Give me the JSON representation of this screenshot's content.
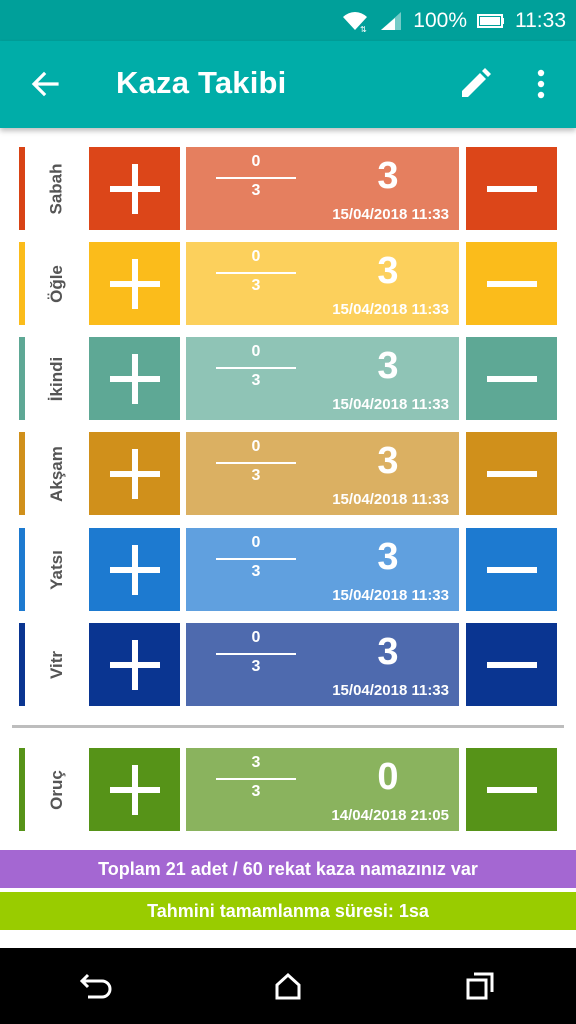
{
  "status_bar": {
    "battery": "100%",
    "time": "11:33"
  },
  "app_bar": {
    "title": "Kaza Takibi"
  },
  "prayers": [
    {
      "name": "Sabah",
      "done": "0",
      "total": "3",
      "remaining": "3",
      "timestamp": "15/04/2018 11:33",
      "stripe": "#d84315",
      "plus": "#dc4619",
      "middle": "#e57f5f",
      "minus": "#dc4619"
    },
    {
      "name": "Öğle",
      "done": "0",
      "total": "3",
      "remaining": "3",
      "timestamp": "15/04/2018 11:33",
      "stripe": "#fbbc1b",
      "plus": "#fbbc1b",
      "middle": "#fcd05c",
      "minus": "#fbbc1b"
    },
    {
      "name": "İkindi",
      "done": "0",
      "total": "3",
      "remaining": "3",
      "timestamp": "15/04/2018 11:33",
      "stripe": "#5ea895",
      "plus": "#5ea895",
      "middle": "#8fc4b6",
      "minus": "#5ea895"
    },
    {
      "name": "Akşam",
      "done": "0",
      "total": "3",
      "remaining": "3",
      "timestamp": "15/04/2018 11:33",
      "stripe": "#d0901b",
      "plus": "#d0901b",
      "middle": "#dbb062",
      "minus": "#d0901b"
    },
    {
      "name": "Yatsı",
      "done": "0",
      "total": "3",
      "remaining": "3",
      "timestamp": "15/04/2018 11:33",
      "stripe": "#1d7ad0",
      "plus": "#1d7ad0",
      "middle": "#60a0df",
      "minus": "#1d7ad0"
    },
    {
      "name": "Vitr",
      "done": "0",
      "total": "3",
      "remaining": "3",
      "timestamp": "15/04/2018 11:33",
      "stripe": "#0a3591",
      "plus": "#0a3591",
      "middle": "#4e6aae",
      "minus": "#0a3591"
    }
  ],
  "fasting": {
    "name": "Oruç",
    "done": "3",
    "total": "3",
    "remaining": "0",
    "timestamp": "14/04/2018 21:05",
    "stripe": "#569318",
    "plus": "#569318",
    "middle": "#8ab35e",
    "minus": "#569318"
  },
  "summary": {
    "total_text": "Toplam 21 adet / 60 rekat kaza namazınız var",
    "total_color": "#a467d2",
    "estimate_text": "Tahmini tamamlanma süresi:  1sa",
    "estimate_color": "#99cc00"
  }
}
